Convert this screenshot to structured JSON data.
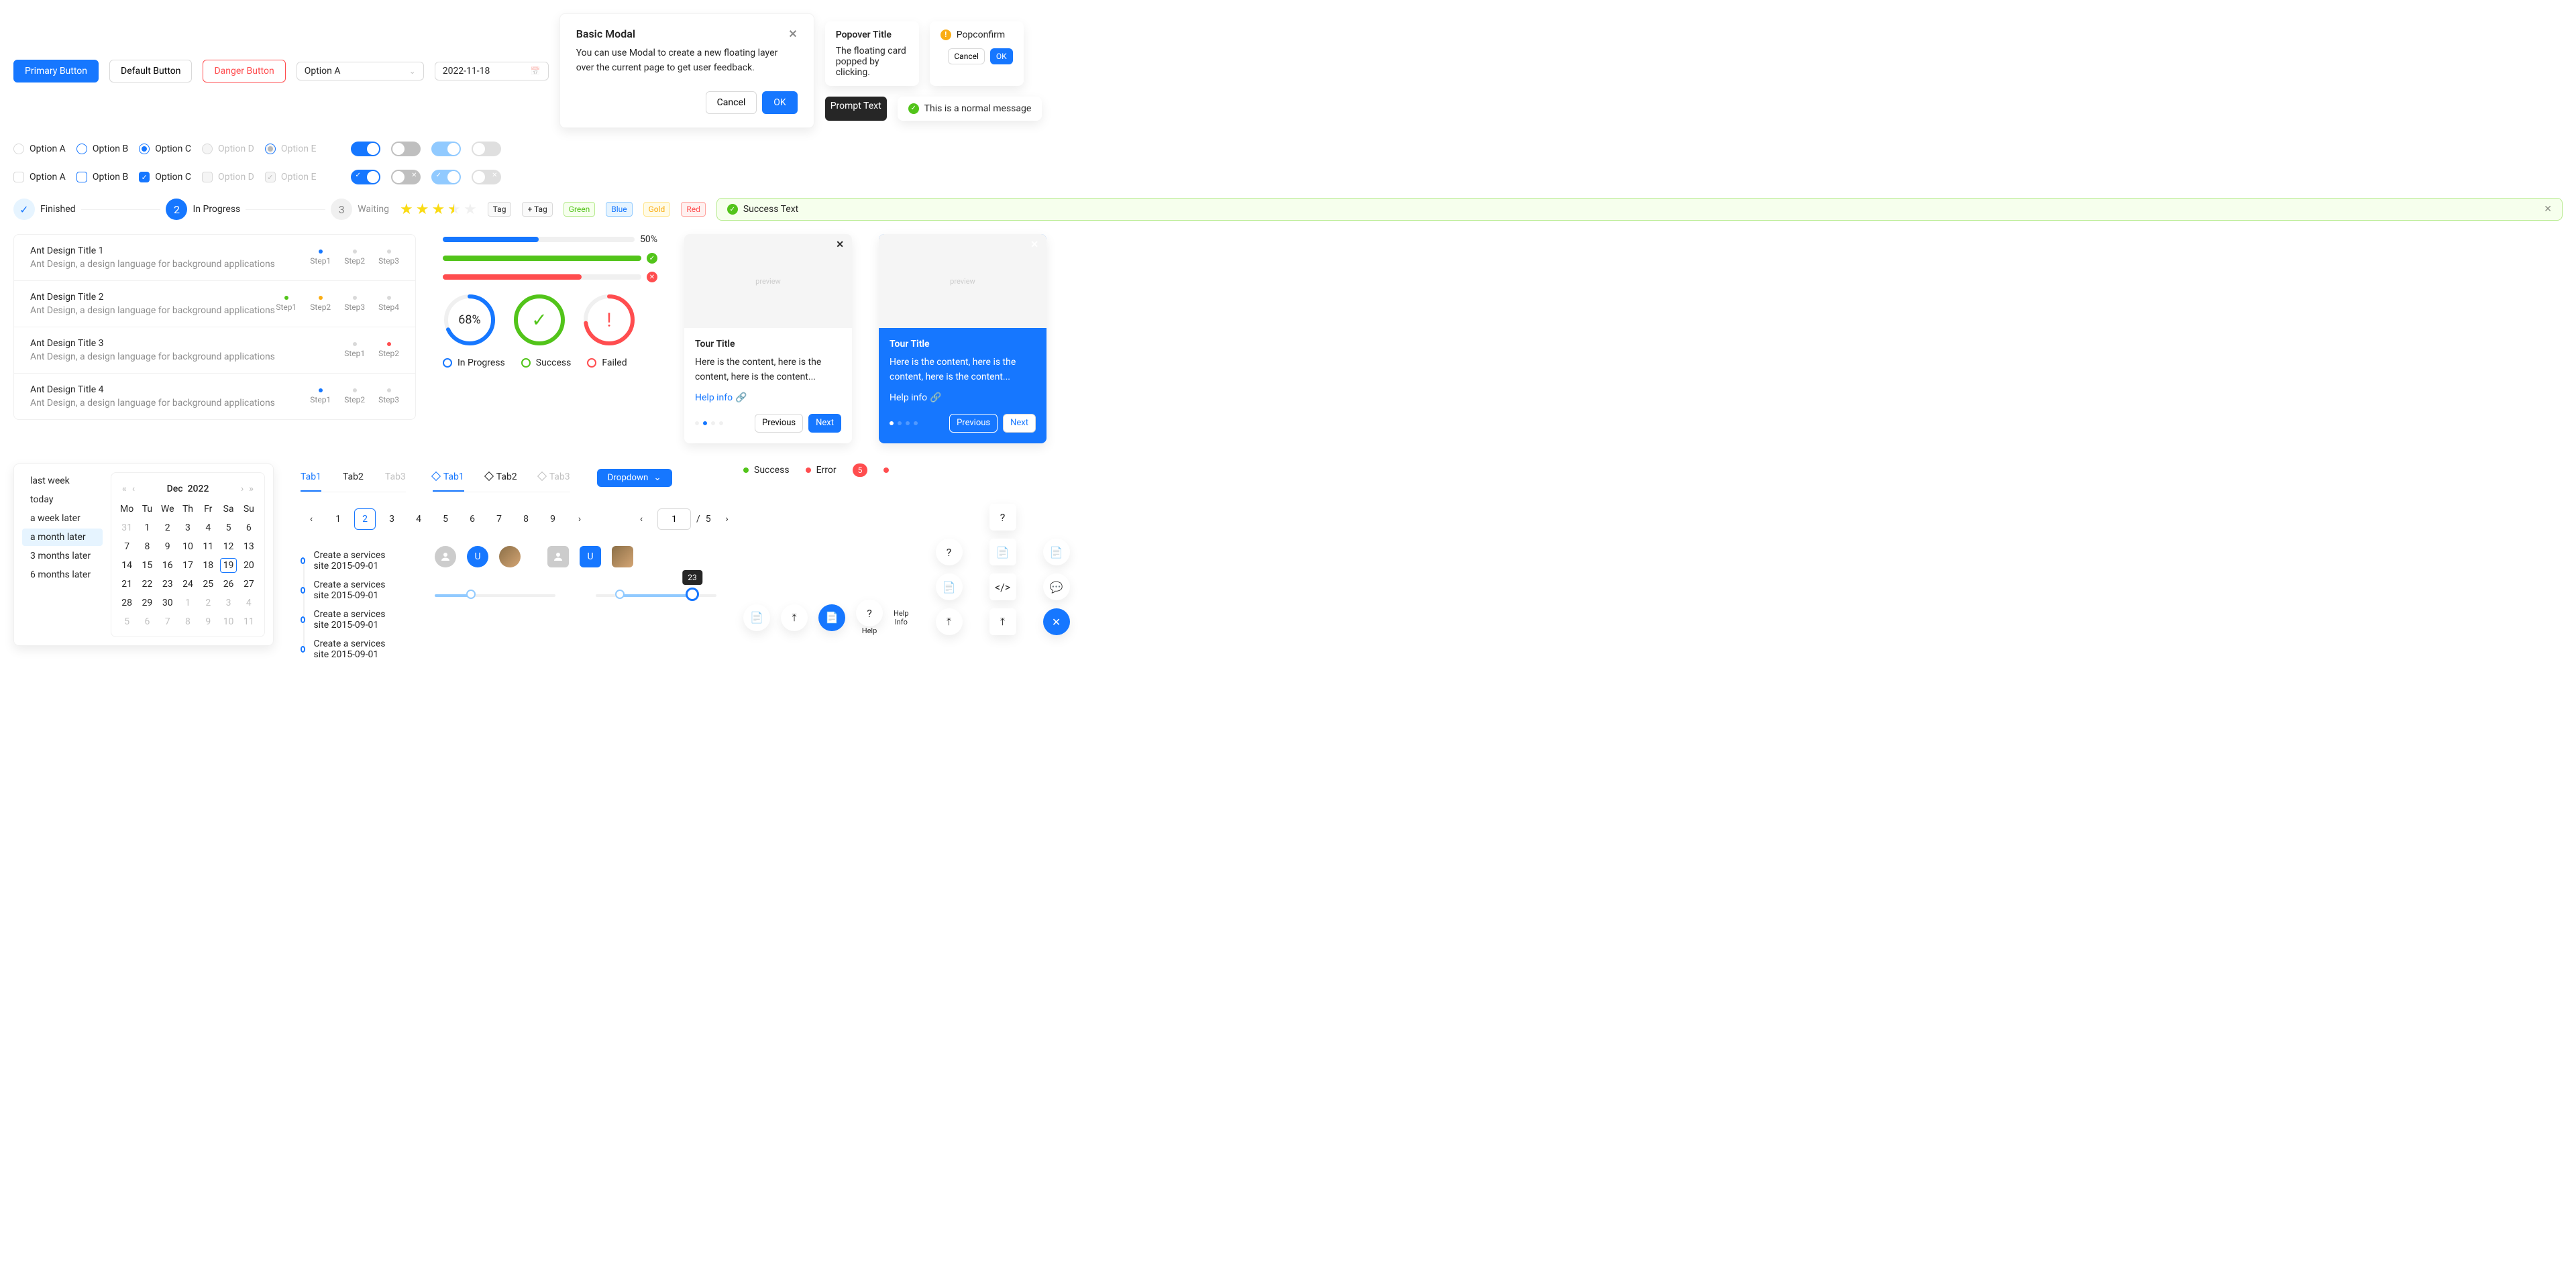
{
  "buttons": {
    "primary": "Primary Button",
    "default": "Default Button",
    "danger": "Danger Button"
  },
  "select": {
    "value": "Option A"
  },
  "date": {
    "value": "2022-11-18"
  },
  "modal": {
    "title": "Basic Modal",
    "body": "You can use Modal to create a new floating layer over the current page to get user feedback.",
    "cancel": "Cancel",
    "ok": "OK"
  },
  "popover": {
    "title": "Popover Title",
    "content": "The floating card popped by clicking."
  },
  "popconfirm": {
    "title": "Popconfirm",
    "cancel": "Cancel",
    "ok": "OK"
  },
  "tooltip": "Prompt Text",
  "message": "This is a normal message",
  "options": {
    "a": "Option A",
    "b": "Option B",
    "c": "Option C",
    "d": "Option D",
    "e": "Option E"
  },
  "steps": {
    "s1": "Finished",
    "s2": "In Progress",
    "s3": "Waiting",
    "n2": "2",
    "n3": "3"
  },
  "tags": {
    "tag": "Tag",
    "addtag": "Tag",
    "green": "Green",
    "blue": "Blue",
    "gold": "Gold",
    "red": "Red"
  },
  "alert": "Success Text",
  "list": {
    "items": [
      {
        "title": "Ant Design Title 1",
        "desc": "Ant Design, a design language for background applications",
        "steps": [
          "Step1",
          "Step2",
          "Step3"
        ]
      },
      {
        "title": "Ant Design Title 2",
        "desc": "Ant Design, a design language for background applications",
        "steps": [
          "Step1",
          "Step2",
          "Step3",
          "Step4"
        ]
      },
      {
        "title": "Ant Design Title 3",
        "desc": "Ant Design, a design language for background applications",
        "steps": [
          "Step1",
          "Step2"
        ]
      },
      {
        "title": "Ant Design Title 4",
        "desc": "Ant Design, a design language for background applications",
        "steps": [
          "Step1",
          "Step2",
          "Step3"
        ]
      }
    ]
  },
  "progress": {
    "p1": "50%",
    "c1": "68%"
  },
  "legend": {
    "inprogress": "In Progress",
    "success": "Success",
    "failed": "Failed"
  },
  "tour": {
    "title": "Tour Title",
    "content": "Here is the content, here is the content, here is the content...",
    "help": "Help info",
    "prev": "Previous",
    "next": "Next"
  },
  "presets": [
    "last week",
    "today",
    "a week later",
    "a month later",
    "3 months later",
    "6 months later"
  ],
  "calendar": {
    "month": "Dec",
    "year": "2022",
    "dow": [
      "Mo",
      "Tu",
      "We",
      "Th",
      "Fr",
      "Sa",
      "Su"
    ],
    "weeks": [
      [
        {
          "d": "31",
          "out": true
        },
        {
          "d": "1"
        },
        {
          "d": "2"
        },
        {
          "d": "3"
        },
        {
          "d": "4"
        },
        {
          "d": "5"
        },
        {
          "d": "6"
        }
      ],
      [
        {
          "d": "7"
        },
        {
          "d": "8"
        },
        {
          "d": "9"
        },
        {
          "d": "10"
        },
        {
          "d": "11"
        },
        {
          "d": "12"
        },
        {
          "d": "13"
        }
      ],
      [
        {
          "d": "14"
        },
        {
          "d": "15"
        },
        {
          "d": "16"
        },
        {
          "d": "17"
        },
        {
          "d": "18"
        },
        {
          "d": "19",
          "today": true
        },
        {
          "d": "20"
        }
      ],
      [
        {
          "d": "21"
        },
        {
          "d": "22"
        },
        {
          "d": "23"
        },
        {
          "d": "24"
        },
        {
          "d": "25"
        },
        {
          "d": "26"
        },
        {
          "d": "27"
        }
      ],
      [
        {
          "d": "28"
        },
        {
          "d": "29"
        },
        {
          "d": "30"
        },
        {
          "d": "1",
          "out": true
        },
        {
          "d": "2",
          "out": true
        },
        {
          "d": "3",
          "out": true
        },
        {
          "d": "4",
          "out": true
        }
      ],
      [
        {
          "d": "5",
          "out": true
        },
        {
          "d": "6",
          "out": true
        },
        {
          "d": "7",
          "out": true
        },
        {
          "d": "8",
          "out": true
        },
        {
          "d": "9",
          "out": true
        },
        {
          "d": "10",
          "out": true
        },
        {
          "d": "11",
          "out": true
        }
      ]
    ]
  },
  "tabs": {
    "t1": "Tab1",
    "t2": "Tab2",
    "t3": "Tab3"
  },
  "dropdown": "Dropdown",
  "pagination": {
    "pages": [
      "1",
      "2",
      "3",
      "4",
      "5",
      "6",
      "7",
      "8",
      "9"
    ],
    "input": "1",
    "sep": "/",
    "total": "5"
  },
  "timeline": [
    "Create a services site 2015-09-01",
    "Create a services site 2015-09-01",
    "Create a services site 2015-09-01",
    "Create a services site 2015-09-01"
  ],
  "avatars": {
    "u": "U"
  },
  "slider": {
    "tip": "23"
  },
  "badges": {
    "success": "Success",
    "error": "Error",
    "count": "5"
  },
  "fbtn": {
    "help": "Help",
    "helpinfo": "Help\nInfo"
  }
}
